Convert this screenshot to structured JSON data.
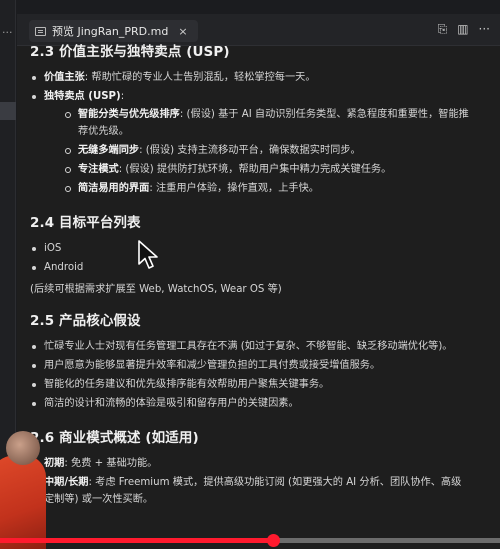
{
  "tab": {
    "title": "预览 JingRan_PRD.md",
    "close": "×"
  },
  "toolbar": {
    "left_menu": "···",
    "actions": [
      "⎘",
      "▥",
      "···"
    ]
  },
  "sections": [
    {
      "heading": "2.3 价值主张与独特卖点 (USP)",
      "items": [
        {
          "bold": "价值主张",
          "text": ": 帮助忙碌的专业人士告别混乱，轻松掌控每一天。"
        },
        {
          "bold": "独特卖点 (USP)",
          "text": ":"
        }
      ],
      "subitems": [
        {
          "bold": "智能分类与优先级排序",
          "text": ": (假设) 基于 AI 自动识别任务类型、紧急程度和重要性，智能推荐优先级。"
        },
        {
          "bold": "无缝多端同步",
          "text": ": (假设) 支持主流移动平台，确保数据实时同步。"
        },
        {
          "bold": "专注模式",
          "text": ": (假设) 提供防打扰环境，帮助用户集中精力完成关键任务。"
        },
        {
          "bold": "简洁易用的界面",
          "text": ": 注重用户体验，操作直观，上手快。"
        }
      ]
    },
    {
      "heading": "2.4 目标平台列表",
      "items": [
        "iOS",
        "Android"
      ],
      "note": "(后续可根据需求扩展至 Web, WatchOS, Wear OS 等)"
    },
    {
      "heading": "2.5 产品核心假设",
      "items": [
        "忙碌专业人士对现有任务管理工具存在不满 (如过于复杂、不够智能、缺乏移动端优化等)。",
        "用户愿意为能够显著提升效率和减少管理负担的工具付费或接受增值服务。",
        "智能化的任务建议和优先级排序能有效帮助用户聚焦关键事务。",
        "简洁的设计和流畅的体验是吸引和留存用户的关键因素。"
      ]
    },
    {
      "heading": "2.6 商业模式概述 (如适用)",
      "items": [
        {
          "bold": "初期",
          "text": ": 免费 + 基础功能。"
        },
        {
          "bold": "中期/长期",
          "text": ": 考虑 Freemium 模式，提供高级功能订阅 (如更强大的 AI 分析、团队协作、高级定制等) 或一次性买断。"
        }
      ]
    }
  ],
  "video": {
    "progress_percent": 54.6
  },
  "colors": {
    "accent": "#ff1a2e",
    "background": "#1e1e1e",
    "text": "#d6d6d6"
  }
}
